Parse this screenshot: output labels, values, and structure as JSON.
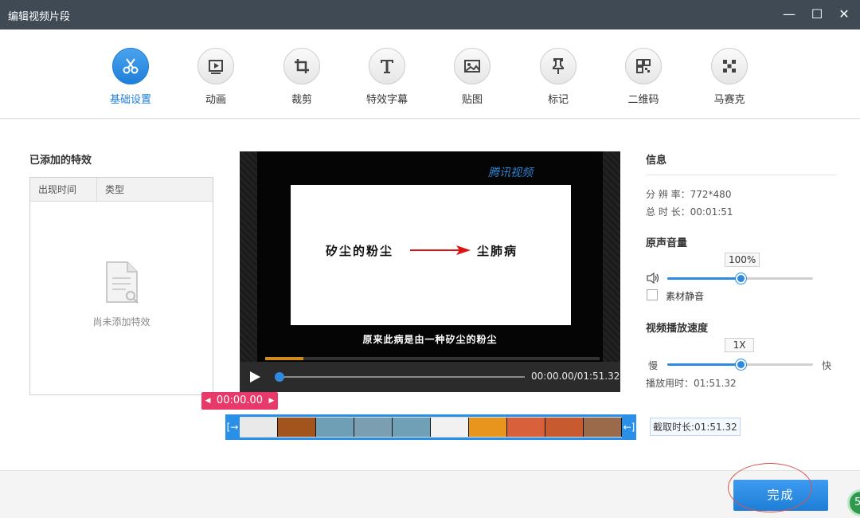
{
  "window": {
    "title": "编辑视频片段",
    "controls": {
      "minimize": "—",
      "maximize": "☐",
      "close": "✕"
    }
  },
  "toolbar": {
    "tabs": [
      {
        "label": "基础设置",
        "icon": "scissors-icon",
        "active": true
      },
      {
        "label": "动画",
        "icon": "play-frame-icon",
        "active": false
      },
      {
        "label": "裁剪",
        "icon": "crop-icon",
        "active": false
      },
      {
        "label": "特效字幕",
        "icon": "text-icon",
        "active": false
      },
      {
        "label": "贴图",
        "icon": "image-icon",
        "active": false
      },
      {
        "label": "标记",
        "icon": "pin-icon",
        "active": false
      },
      {
        "label": "二维码",
        "icon": "qrcode-icon",
        "active": false
      },
      {
        "label": "马赛克",
        "icon": "mosaic-icon",
        "active": false
      }
    ]
  },
  "effects": {
    "title": "已添加的特效",
    "columns": [
      "出现时间",
      "类型"
    ],
    "empty_text": "尚未添加特效"
  },
  "player": {
    "watermark": "腾讯视频",
    "slide_left": "矽尘的粉尘",
    "slide_right": "尘肺病",
    "subtitle": "原来此病是由一种矽尘的粉尘",
    "timecode": "00:00.00/01:51.32",
    "progress": 0.0
  },
  "timeline": {
    "handle_time": "00:00.00",
    "cut_length": "截取时长:01:51.32",
    "left_edge": "[→",
    "right_edge": "←]",
    "frame_colors": [
      "#e9e9e9",
      "#a3541c",
      "#6e9fb5",
      "#7b9fb0",
      "#6fa0b5",
      "#f1f1f1",
      "#e8951e",
      "#d8603a",
      "#c85a30",
      "#9a6a4a"
    ]
  },
  "info": {
    "title": "信息",
    "resolution_label": "分 辨 率：",
    "resolution_value": "772*480",
    "duration_label": "总 时 长：",
    "duration_value": "00:01:51",
    "volume_title": "原声音量",
    "volume_value": "100%",
    "volume_level": 0.5,
    "mute_label": "素材静音",
    "speed_title": "视频播放速度",
    "speed_value": "1X",
    "speed_level": 0.5,
    "speed_slow": "慢",
    "speed_fast": "快",
    "play_time_label": "播放用时：",
    "play_time_value": "01:51.32"
  },
  "footer": {
    "done_label": "完成",
    "badge": "5"
  },
  "colors": {
    "accent": "#2c8be0",
    "titlebar": "#3f4a55",
    "handle": "#e83a6a"
  }
}
